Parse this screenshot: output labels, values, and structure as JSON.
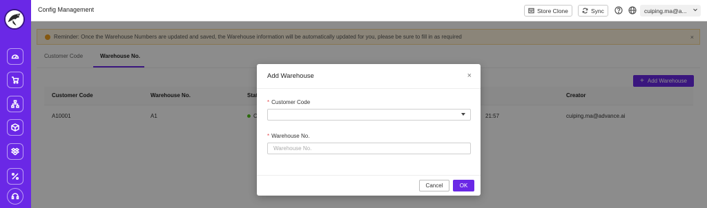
{
  "header": {
    "title": "Config Management",
    "store_clone_label": "Store Clone",
    "sync_label": "Sync",
    "user_label": "cuiping.ma@a..."
  },
  "reminder": {
    "text": "Reminder: Once the Warehouse Numbers are updated and saved, the Warehouse information will be automatically updated for you, please be sure to fill in as required",
    "close": "×"
  },
  "tabs": [
    {
      "label": "Customer Code",
      "active": false
    },
    {
      "label": "Warehouse No.",
      "active": true
    }
  ],
  "toolbar": {
    "add_label": "Add Warehouse"
  },
  "table": {
    "columns": [
      "Customer Code",
      "Warehouse No.",
      "Stat",
      "Creator"
    ],
    "rows": [
      {
        "customer_code": "A10001",
        "warehouse_no": "A1",
        "status": "C",
        "time_fragment": "21:57",
        "creator": "cuiping.ma@advance.ai"
      }
    ]
  },
  "modal": {
    "title": "Add Warehouse",
    "close": "×",
    "customer_code_label": "Customer Code",
    "customer_code_value": "",
    "warehouse_no_label": "Warehouse No.",
    "warehouse_no_value": "",
    "warehouse_no_placeholder": "Warehouse No.",
    "required_mark": "*",
    "cancel_label": "Cancel",
    "ok_label": "OK"
  },
  "icons": {
    "sidebar": [
      "dashboard-icon",
      "cart-icon",
      "org-chart-icon",
      "box-icon",
      "dropbox-icon",
      "percent-icon",
      "headset-icon"
    ],
    "header": [
      "store-icon",
      "sync-icon",
      "help-icon",
      "globe-icon",
      "chevron-down-icon"
    ]
  },
  "colors": {
    "brand": "#6a28e6",
    "warning": "#f0a020",
    "success": "#52c41a",
    "required": "#e5484d"
  }
}
